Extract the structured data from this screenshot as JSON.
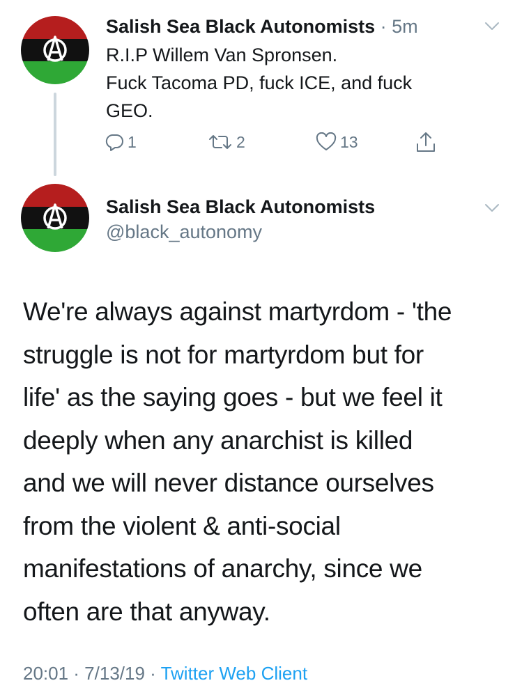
{
  "tweet1": {
    "display_name": "Salish Sea Black Autonomists",
    "separator": "·",
    "time_ago": "5m",
    "text_lines": [
      "R.I.P Willem Van Spronsen.",
      "Fuck Tacoma PD, fuck ICE, and fuck",
      "GEO."
    ],
    "reply_count": "1",
    "retweet_count": "2",
    "like_count": "13",
    "icons": {
      "reply": "reply-icon",
      "retweet": "retweet-icon",
      "like": "heart-icon",
      "share": "share-icon",
      "menu": "chevron-down-icon"
    }
  },
  "tweet2": {
    "display_name": "Salish Sea Black Autonomists",
    "handle": "@black_autonomy",
    "text_lines": [
      "We're always against martyrdom - 'the",
      "struggle is not for martyrdom but for",
      "life' as the saying goes - but we feel it",
      "deeply when any anarchist is killed",
      "and we will never distance ourselves",
      "from the violent & anti-social",
      "manifestations of anarchy, since we",
      "often are that anyway."
    ],
    "timestamp": "20:01 · 7/13/19 · ",
    "client": "Twitter Web Client"
  },
  "colors": {
    "avatar_red": "#b51e1e",
    "avatar_black": "#111111",
    "avatar_green": "#2fa836",
    "secondary_text": "#657786",
    "link_blue": "#1da1f2",
    "thread_line": "#ccd6dd"
  }
}
